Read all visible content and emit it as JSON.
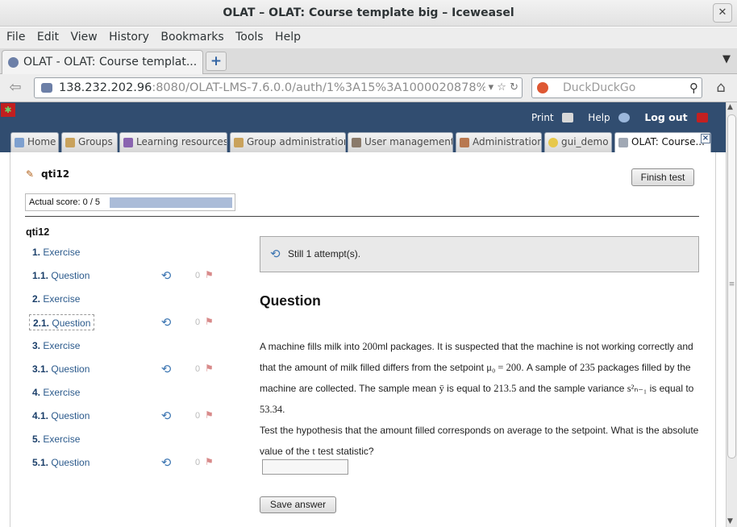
{
  "window": {
    "title": "OLAT – OLAT: Course template big – Iceweasel"
  },
  "menu": {
    "items": [
      "File",
      "Edit",
      "View",
      "History",
      "Bookmarks",
      "Tools",
      "Help"
    ]
  },
  "browser": {
    "tab_title": "OLAT - OLAT: Course templat...",
    "url_host": "138.232.202.96",
    "url_rest": ":8080/OLAT-LMS-7.6.0.0/auth/1%3A15%3A1000020878%3",
    "search_placeholder": "DuckDuckGo"
  },
  "olat_header": {
    "print": "Print",
    "help": "Help",
    "logout": "Log out"
  },
  "olat_tabs": [
    "Home",
    "Groups",
    "Learning resources",
    "Group administration",
    "User management",
    "Administration",
    "gui_demo",
    "OLAT: Course..."
  ],
  "test": {
    "title": "qti12",
    "finish_label": "Finish test",
    "score_label": "Actual score: 0 / 5",
    "score_fraction": 0
  },
  "nav": {
    "title": "qti12",
    "items": [
      {
        "num": "1.",
        "label": "Exercise",
        "type": "exercise"
      },
      {
        "num": "1.1.",
        "label": "Question",
        "type": "question",
        "score": "0"
      },
      {
        "num": "2.",
        "label": "Exercise",
        "type": "exercise"
      },
      {
        "num": "2.1.",
        "label": "Question",
        "type": "question",
        "score": "0",
        "selected": true
      },
      {
        "num": "3.",
        "label": "Exercise",
        "type": "exercise"
      },
      {
        "num": "3.1.",
        "label": "Question",
        "type": "question",
        "score": "0"
      },
      {
        "num": "4.",
        "label": "Exercise",
        "type": "exercise"
      },
      {
        "num": "4.1.",
        "label": "Question",
        "type": "question",
        "score": "0"
      },
      {
        "num": "5.",
        "label": "Exercise",
        "type": "exercise"
      },
      {
        "num": "5.1.",
        "label": "Question",
        "type": "question",
        "score": "0"
      }
    ]
  },
  "question": {
    "attempts": "Still 1 attempt(s).",
    "heading": "Question",
    "t1": "A machine fills milk into ",
    "m1": "200",
    "t2": "ml packages. It is suspected that the machine is not working correctly and that the amount of milk filled differs from the setpoint ",
    "m2": "μ₀ = 200",
    "t3": ". A sample of ",
    "m3": "235",
    "t4": " packages filled by the machine are collected. The sample mean ",
    "m4": "ȳ",
    "t5": " is equal to ",
    "m5": "213.5",
    "t6": " and the sample variance ",
    "m6": "s²ₙ₋₁",
    "t7": " is equal to ",
    "m7": "53.34",
    "t8": ".",
    "t9": "Test the hypothesis that the amount filled corresponds on average to the setpoint. What is the absolute value of the ",
    "m9": "t",
    "t10": " test statistic?",
    "answer_value": "",
    "save_label": "Save answer"
  }
}
